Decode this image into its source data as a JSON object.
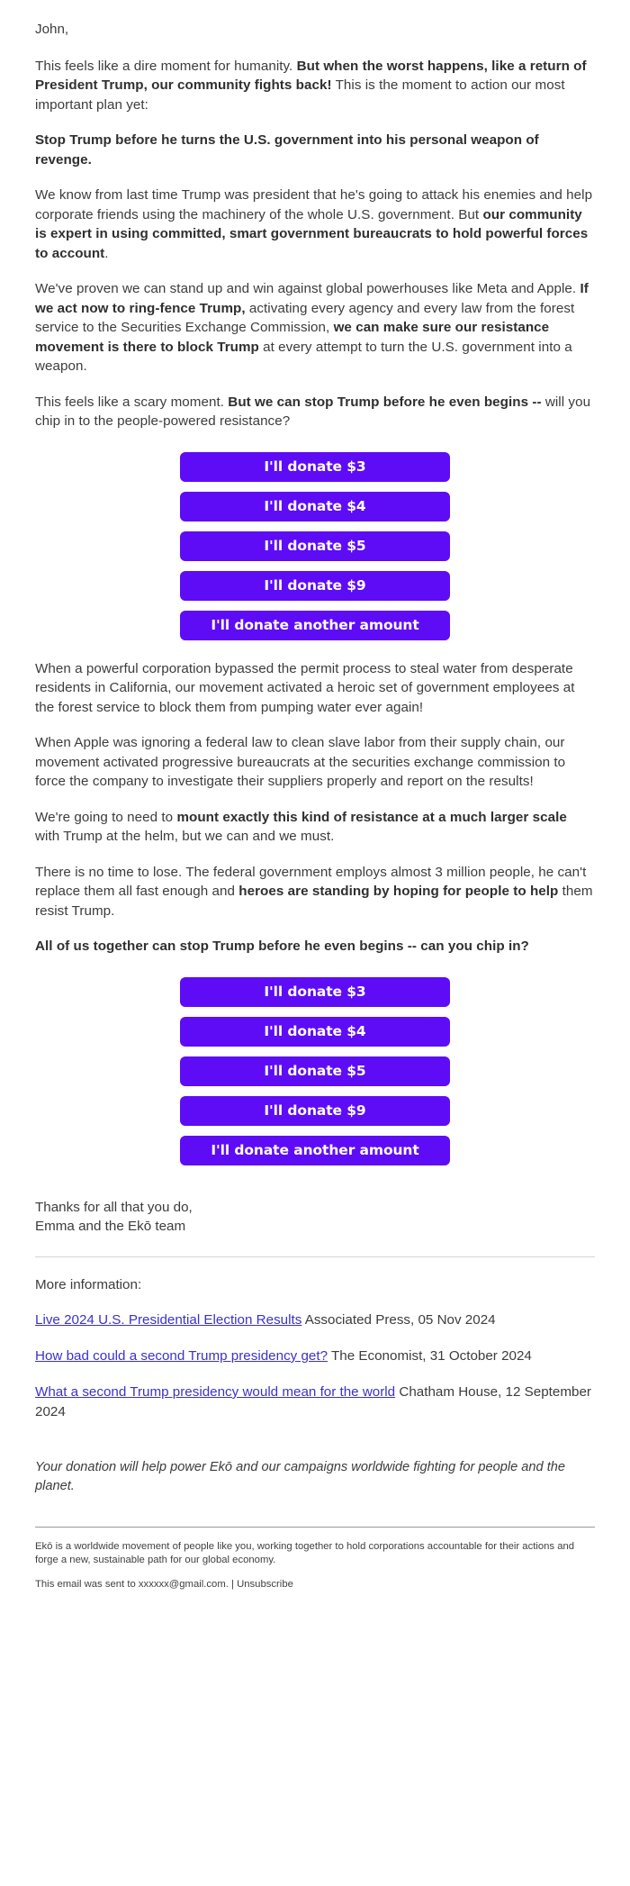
{
  "email": {
    "greeting": "John,",
    "paragraphs": [
      {
        "id": "p1",
        "runs": [
          {
            "t": "This feels like a dire moment for humanity. ",
            "b": false
          },
          {
            "t": "But when the worst happens, like a return of President Trump, our community fights back!",
            "b": true
          },
          {
            "t": " This is the moment to action our most important plan yet:",
            "b": false
          }
        ]
      },
      {
        "id": "p2",
        "runs": [
          {
            "t": "Stop Trump before he turns the U.S. government into his personal weapon of revenge.",
            "b": true
          }
        ]
      },
      {
        "id": "p3",
        "runs": [
          {
            "t": "We know from last time Trump was president that he's going to attack his enemies and help corporate friends using the machinery of the whole U.S. government. But ",
            "b": false
          },
          {
            "t": "our community is expert in using committed, smart government bureaucrats to hold powerful forces to account",
            "b": true
          },
          {
            "t": ".",
            "b": false
          }
        ]
      },
      {
        "id": "p4",
        "runs": [
          {
            "t": "We've proven we can stand up and win against global powerhouses like Meta and Apple. ",
            "b": false
          },
          {
            "t": "If we act now to ring-fence Trump,",
            "b": true
          },
          {
            "t": " activating every agency and every law from the forest service to the Securities Exchange Commission, ",
            "b": false
          },
          {
            "t": "we can make sure our resistance movement is there to block Trump",
            "b": true
          },
          {
            "t": " at every attempt to turn the U.S. government into a weapon.",
            "b": false
          }
        ]
      },
      {
        "id": "p5",
        "runs": [
          {
            "t": "This feels like a scary moment. ",
            "b": false
          },
          {
            "t": "But we can stop Trump before he even begins --",
            "b": true
          },
          {
            "t": " will you chip in to the people-powered resistance?",
            "b": false
          }
        ]
      }
    ],
    "paragraphs_two": [
      {
        "id": "p6",
        "runs": [
          {
            "t": "When a powerful corporation bypassed the permit process to steal water from desperate residents in California, our movement activated a heroic set of government employees at the forest service to block them from pumping water ever again!",
            "b": false
          }
        ]
      },
      {
        "id": "p7",
        "runs": [
          {
            "t": "When Apple was ignoring a federal law to clean slave labor from their supply chain, our movement activated progressive bureaucrats at the securities exchange commission to force the company to investigate their suppliers properly and report on the results!",
            "b": false
          }
        ]
      },
      {
        "id": "p8",
        "runs": [
          {
            "t": "We're going to need to ",
            "b": false
          },
          {
            "t": "mount exactly this kind of resistance at a much larger scale",
            "b": true
          },
          {
            "t": " with Trump at the helm, but we can and we must.",
            "b": false
          }
        ]
      },
      {
        "id": "p9",
        "runs": [
          {
            "t": "There is no time to lose. The federal government employs almost 3 million people, he can't replace them all fast enough and ",
            "b": false
          },
          {
            "t": "heroes are standing by hoping for people to help",
            "b": true
          },
          {
            "t": " them resist Trump.",
            "b": false
          }
        ]
      },
      {
        "id": "p10",
        "runs": [
          {
            "t": "All of us together can stop Trump before he even begins -- can you chip in?",
            "b": true
          }
        ]
      }
    ],
    "donate_buttons": [
      "I'll donate $3",
      "I'll donate $4",
      "I'll donate $5",
      "I'll donate $9",
      "I'll donate another amount"
    ],
    "signature_line1": "Thanks for all that you do,",
    "signature_line2": "Emma and the Ekō team",
    "more_information_label": "More information:",
    "references": [
      {
        "link_text": "Live 2024 U.S. Presidential Election Results",
        "source_text": " Associated Press, 05 Nov 2024"
      },
      {
        "link_text": "How bad could a second Trump presidency get?",
        "source_text": " The Economist, 31 October 2024"
      },
      {
        "link_text": "What a second Trump presidency would mean for the world",
        "source_text": " Chatham House, 12 September 2024"
      }
    ],
    "disclaimer": "Your donation will help power Ekō and our campaigns worldwide fighting for people and the planet.",
    "footer_about": "Ekō is a worldwide movement of people like you, working together to hold corporations accountable for their actions and forge a new, sustainable path for our global economy.",
    "footer_sent_prefix": "This email was sent to xxxxxx@gmail.com. | ",
    "footer_unsubscribe": "Unsubscribe"
  },
  "colors": {
    "button_purple": "#5e0cf5",
    "link_blue": "#3b32c8",
    "body_text": "#3c3c3c"
  }
}
